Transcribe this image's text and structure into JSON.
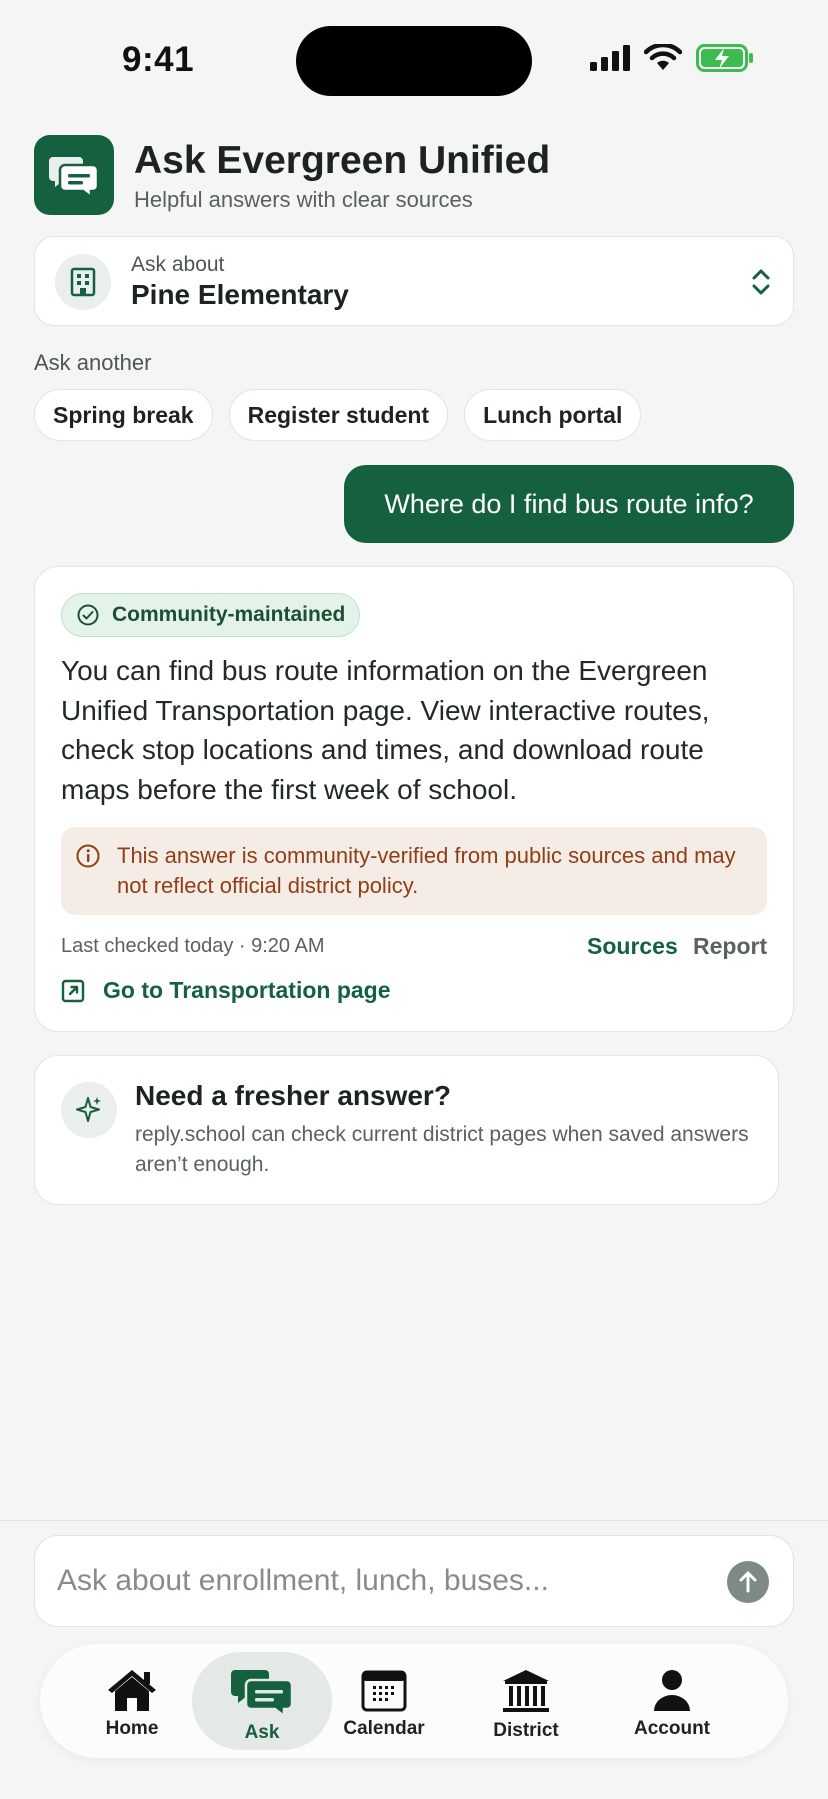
{
  "status_bar": {
    "time": "9:41"
  },
  "app": {
    "title": "Ask Evergreen Unified",
    "subtitle": "Helpful answers with clear sources",
    "icon": "chat-bubbles-icon"
  },
  "school_picker": {
    "label": "Ask about",
    "value": "Pine Elementary"
  },
  "suggestions": {
    "label": "Ask another",
    "chips": [
      "Spring break",
      "Register student",
      "Lunch portal"
    ]
  },
  "conversation": {
    "user_message": "Where do I find bus route info?",
    "answer": {
      "badge": "Community-maintained",
      "text": "You can find bus route information on the Evergreen Unified Transportation page. View interactive routes, check stop locations and times, and download route maps before the first week of school.",
      "disclaimer": "This answer is community-verified from public sources and may not reflect official district policy.",
      "last_checked": "Last checked today · 9:20 AM",
      "sources_label": "Sources",
      "report_label": "Report",
      "link_label": "Go to Transportation page"
    }
  },
  "fresh_prompt": {
    "title": "Need a fresher answer?",
    "body": "reply.school can check current district pages when saved answers aren’t enough."
  },
  "composer": {
    "placeholder": "Ask about enrollment, lunch, buses..."
  },
  "tabs": [
    {
      "label": "Home",
      "icon": "home-icon",
      "active": false
    },
    {
      "label": "Ask",
      "icon": "chat-bubbles-icon",
      "active": true
    },
    {
      "label": "Calendar",
      "icon": "calendar-icon",
      "active": false
    },
    {
      "label": "District",
      "icon": "district-building-icon",
      "active": false
    },
    {
      "label": "Account",
      "icon": "account-icon",
      "active": false
    }
  ],
  "colors": {
    "brand_green": "#15603e",
    "badge_bg": "#e4f3e9",
    "warning_bg": "#f6ece6",
    "warning_text": "#8f3e17",
    "page_bg": "#f4f5f4"
  }
}
